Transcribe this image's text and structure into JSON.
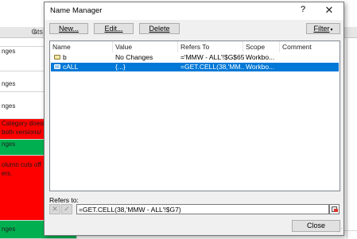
{
  "sheet": {
    "column_header_left": "nts",
    "column_header_g": "G",
    "cells": [
      "nges",
      "nges",
      "nges",
      "Category doesn",
      "both versions/",
      "nges",
      "olumn cuts off",
      "ers.",
      "nges"
    ],
    "colors": {
      "red": "#ff0000",
      "green": "#00b050"
    }
  },
  "dialog": {
    "title": "Name Manager",
    "help": "?",
    "close": "✕",
    "buttons": {
      "new": "New...",
      "edit": "Edit...",
      "delete": "Delete",
      "filter": "Filter",
      "close": "Close"
    },
    "list": {
      "headers": [
        "Name",
        "Value",
        "Refers To",
        "Scope",
        "Comment"
      ],
      "rows": [
        {
          "name": "b",
          "value": "No Changes",
          "refers_to": "='MMW - ALL'!$G$65",
          "scope": "Workbo...",
          "comment": ""
        },
        {
          "name": "cALL",
          "value": "{...}",
          "refers_to": "=GET.CELL(38,'MM...",
          "scope": "Workbo...",
          "comment": ""
        }
      ]
    },
    "refers_to_label": "Refers to:",
    "refers_to_value": "=GET.CELL(38,'MMW - ALL'!$G7)",
    "accent": "#0078d7"
  }
}
